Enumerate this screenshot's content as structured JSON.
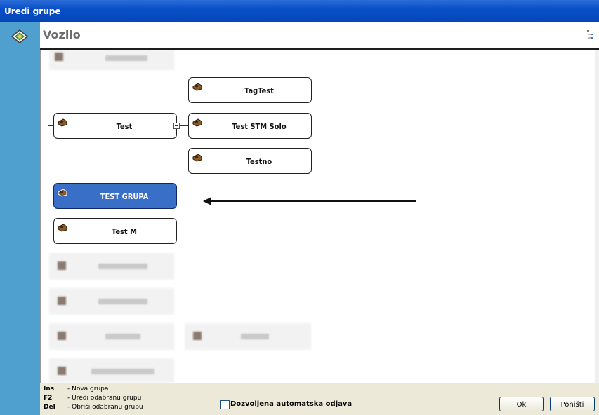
{
  "window": {
    "title": "Uredi grupe"
  },
  "header": {
    "title": "Vozilo"
  },
  "tree": {
    "parent": "Test",
    "children": [
      "TagTest",
      "Test STM Solo",
      "Testno"
    ],
    "selected": "TEST GRUPA",
    "sibling": "Test M"
  },
  "shortcuts": [
    {
      "key": "Ins",
      "desc": "- Nova grupa"
    },
    {
      "key": "F2",
      "desc": "- Uredi odabranu grupu"
    },
    {
      "key": "Del",
      "desc": "- Obriši odabranu grupu"
    }
  ],
  "options": {
    "auto_logout_label": "Dozvoljena automatska odjava",
    "auto_logout_checked": false
  },
  "buttons": {
    "ok": "Ok",
    "cancel": "Poništi"
  },
  "colors": {
    "titlebar": "#0a4fc7",
    "sidebar": "#4f9fcf",
    "selected_node": "#3a6fc7"
  }
}
